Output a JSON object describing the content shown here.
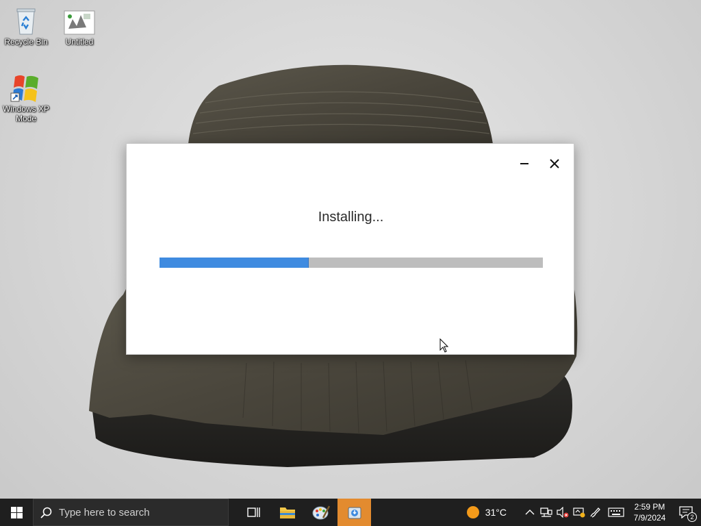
{
  "desktop": {
    "icons": [
      {
        "label": "Recycle Bin"
      },
      {
        "label": "Untitled"
      },
      {
        "label": "Windows XP Mode"
      }
    ]
  },
  "installer": {
    "status_text": "Installing...",
    "progress_fraction": 0.39
  },
  "taskbar": {
    "search_placeholder": "Type here to search",
    "weather_temp": "31°C",
    "clock_time": "2:59 PM",
    "clock_date": "7/9/2024",
    "notification_count": "2",
    "active_app_color": "#e38b2f"
  },
  "colors": {
    "progress_fill": "#3f8be0",
    "progress_track": "#bdbdbd",
    "taskbar_bg": "#1f1f1f"
  }
}
